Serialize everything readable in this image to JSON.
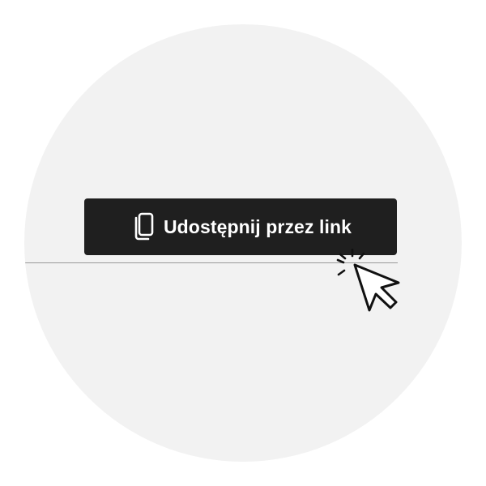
{
  "share_button": {
    "label": "Udostępnij przez link",
    "icon": "copy-icon"
  },
  "cursor": {
    "icon": "pointer-cursor-click-icon"
  },
  "colors": {
    "button_background": "#1f1f1f",
    "button_text": "#ffffff",
    "circle_background": "#f2f2f2",
    "divider": "#9a9a9a",
    "page_background": "#ffffff"
  }
}
